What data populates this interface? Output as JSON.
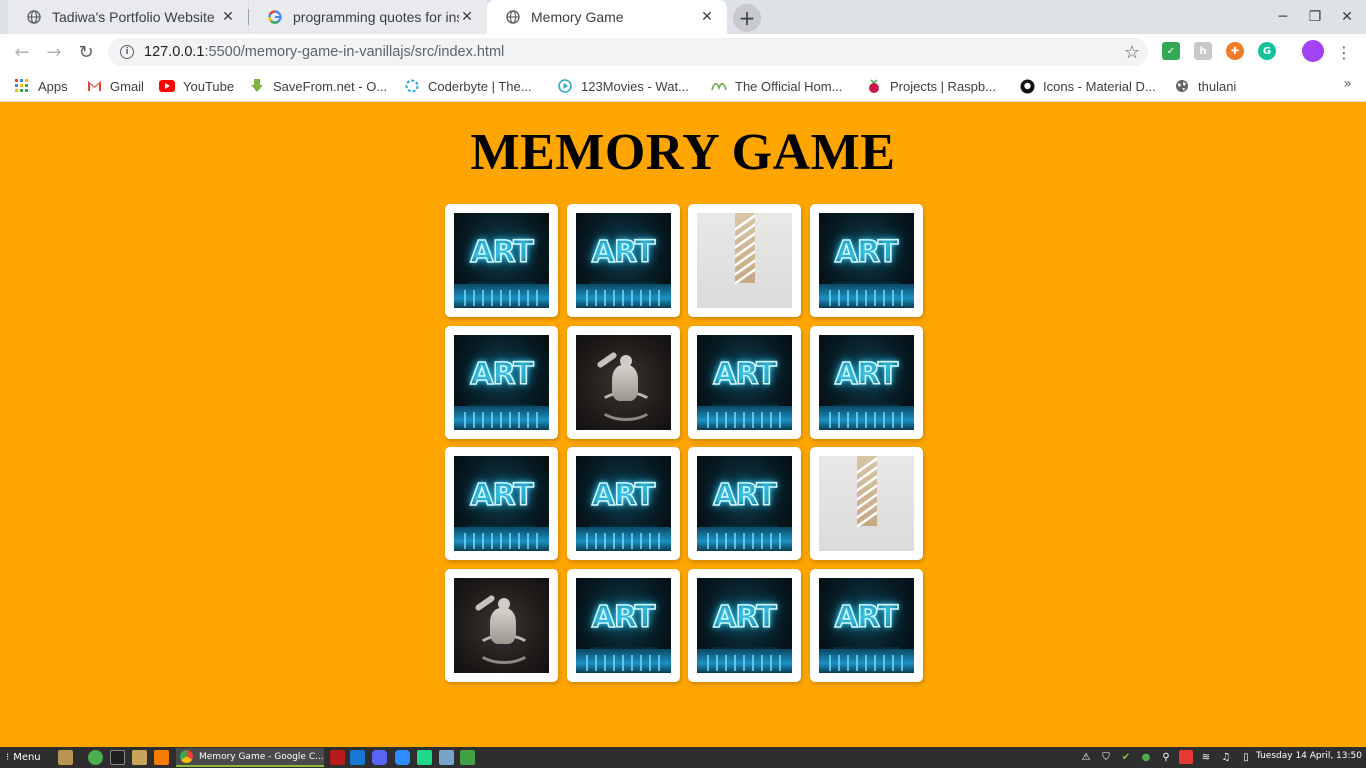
{
  "browser": {
    "tabs": [
      {
        "title": "Tadiwa's Portfolio Website",
        "icon": "globe-icon",
        "active": false
      },
      {
        "title": "programming quotes for insp",
        "icon": "google-icon",
        "active": false
      },
      {
        "title": "Memory Game",
        "icon": "globe-icon",
        "active": true
      }
    ],
    "address": {
      "host": "127.0.0.1",
      "path": ":5500/memory-game-in-vanillajs/src/index.html"
    },
    "bookmarks": [
      {
        "label": "Apps",
        "icon": "apps-grid-icon"
      },
      {
        "label": "Gmail",
        "icon": "gmail-icon"
      },
      {
        "label": "YouTube",
        "icon": "youtube-icon"
      },
      {
        "label": "SaveFrom.net - O...",
        "icon": "savefrom-icon"
      },
      {
        "label": "Coderbyte | The...",
        "icon": "coderbyte-icon"
      },
      {
        "label": "123Movies - Wat...",
        "icon": "play-circle-icon"
      },
      {
        "label": "The Official Hom...",
        "icon": "official-home-icon"
      },
      {
        "label": "Projects | Raspb...",
        "icon": "raspberry-icon"
      },
      {
        "label": "Icons - Material D...",
        "icon": "github-icon"
      },
      {
        "label": "thulani",
        "icon": "globe-icon"
      }
    ]
  },
  "page": {
    "title": "MEMORY GAME",
    "cards": [
      "art",
      "art",
      "stairs",
      "art",
      "art",
      "statue",
      "art",
      "art",
      "art",
      "art",
      "art",
      "stairs",
      "statue",
      "art",
      "art",
      "art"
    ],
    "background_color": "#ffa500"
  },
  "taskbar": {
    "menu_label": "Menu",
    "active_window": "Memory Game - Google C...",
    "clock": "Tuesday 14 April, 13:50"
  }
}
